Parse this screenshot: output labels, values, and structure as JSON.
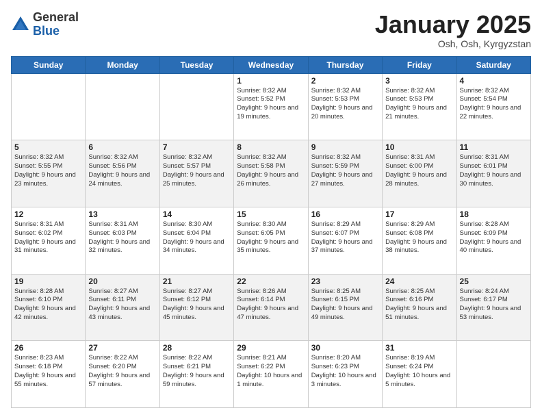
{
  "logo": {
    "general": "General",
    "blue": "Blue"
  },
  "header": {
    "month": "January 2025",
    "location": "Osh, Osh, Kyrgyzstan"
  },
  "weekdays": [
    "Sunday",
    "Monday",
    "Tuesday",
    "Wednesday",
    "Thursday",
    "Friday",
    "Saturday"
  ],
  "weeks": [
    [
      {
        "day": "",
        "info": ""
      },
      {
        "day": "",
        "info": ""
      },
      {
        "day": "",
        "info": ""
      },
      {
        "day": "1",
        "info": "Sunrise: 8:32 AM\nSunset: 5:52 PM\nDaylight: 9 hours\nand 19 minutes."
      },
      {
        "day": "2",
        "info": "Sunrise: 8:32 AM\nSunset: 5:53 PM\nDaylight: 9 hours\nand 20 minutes."
      },
      {
        "day": "3",
        "info": "Sunrise: 8:32 AM\nSunset: 5:53 PM\nDaylight: 9 hours\nand 21 minutes."
      },
      {
        "day": "4",
        "info": "Sunrise: 8:32 AM\nSunset: 5:54 PM\nDaylight: 9 hours\nand 22 minutes."
      }
    ],
    [
      {
        "day": "5",
        "info": "Sunrise: 8:32 AM\nSunset: 5:55 PM\nDaylight: 9 hours\nand 23 minutes."
      },
      {
        "day": "6",
        "info": "Sunrise: 8:32 AM\nSunset: 5:56 PM\nDaylight: 9 hours\nand 24 minutes."
      },
      {
        "day": "7",
        "info": "Sunrise: 8:32 AM\nSunset: 5:57 PM\nDaylight: 9 hours\nand 25 minutes."
      },
      {
        "day": "8",
        "info": "Sunrise: 8:32 AM\nSunset: 5:58 PM\nDaylight: 9 hours\nand 26 minutes."
      },
      {
        "day": "9",
        "info": "Sunrise: 8:32 AM\nSunset: 5:59 PM\nDaylight: 9 hours\nand 27 minutes."
      },
      {
        "day": "10",
        "info": "Sunrise: 8:31 AM\nSunset: 6:00 PM\nDaylight: 9 hours\nand 28 minutes."
      },
      {
        "day": "11",
        "info": "Sunrise: 8:31 AM\nSunset: 6:01 PM\nDaylight: 9 hours\nand 30 minutes."
      }
    ],
    [
      {
        "day": "12",
        "info": "Sunrise: 8:31 AM\nSunset: 6:02 PM\nDaylight: 9 hours\nand 31 minutes."
      },
      {
        "day": "13",
        "info": "Sunrise: 8:31 AM\nSunset: 6:03 PM\nDaylight: 9 hours\nand 32 minutes."
      },
      {
        "day": "14",
        "info": "Sunrise: 8:30 AM\nSunset: 6:04 PM\nDaylight: 9 hours\nand 34 minutes."
      },
      {
        "day": "15",
        "info": "Sunrise: 8:30 AM\nSunset: 6:05 PM\nDaylight: 9 hours\nand 35 minutes."
      },
      {
        "day": "16",
        "info": "Sunrise: 8:29 AM\nSunset: 6:07 PM\nDaylight: 9 hours\nand 37 minutes."
      },
      {
        "day": "17",
        "info": "Sunrise: 8:29 AM\nSunset: 6:08 PM\nDaylight: 9 hours\nand 38 minutes."
      },
      {
        "day": "18",
        "info": "Sunrise: 8:28 AM\nSunset: 6:09 PM\nDaylight: 9 hours\nand 40 minutes."
      }
    ],
    [
      {
        "day": "19",
        "info": "Sunrise: 8:28 AM\nSunset: 6:10 PM\nDaylight: 9 hours\nand 42 minutes."
      },
      {
        "day": "20",
        "info": "Sunrise: 8:27 AM\nSunset: 6:11 PM\nDaylight: 9 hours\nand 43 minutes."
      },
      {
        "day": "21",
        "info": "Sunrise: 8:27 AM\nSunset: 6:12 PM\nDaylight: 9 hours\nand 45 minutes."
      },
      {
        "day": "22",
        "info": "Sunrise: 8:26 AM\nSunset: 6:14 PM\nDaylight: 9 hours\nand 47 minutes."
      },
      {
        "day": "23",
        "info": "Sunrise: 8:25 AM\nSunset: 6:15 PM\nDaylight: 9 hours\nand 49 minutes."
      },
      {
        "day": "24",
        "info": "Sunrise: 8:25 AM\nSunset: 6:16 PM\nDaylight: 9 hours\nand 51 minutes."
      },
      {
        "day": "25",
        "info": "Sunrise: 8:24 AM\nSunset: 6:17 PM\nDaylight: 9 hours\nand 53 minutes."
      }
    ],
    [
      {
        "day": "26",
        "info": "Sunrise: 8:23 AM\nSunset: 6:18 PM\nDaylight: 9 hours\nand 55 minutes."
      },
      {
        "day": "27",
        "info": "Sunrise: 8:22 AM\nSunset: 6:20 PM\nDaylight: 9 hours\nand 57 minutes."
      },
      {
        "day": "28",
        "info": "Sunrise: 8:22 AM\nSunset: 6:21 PM\nDaylight: 9 hours\nand 59 minutes."
      },
      {
        "day": "29",
        "info": "Sunrise: 8:21 AM\nSunset: 6:22 PM\nDaylight: 10 hours\nand 1 minute."
      },
      {
        "day": "30",
        "info": "Sunrise: 8:20 AM\nSunset: 6:23 PM\nDaylight: 10 hours\nand 3 minutes."
      },
      {
        "day": "31",
        "info": "Sunrise: 8:19 AM\nSunset: 6:24 PM\nDaylight: 10 hours\nand 5 minutes."
      },
      {
        "day": "",
        "info": ""
      }
    ]
  ]
}
